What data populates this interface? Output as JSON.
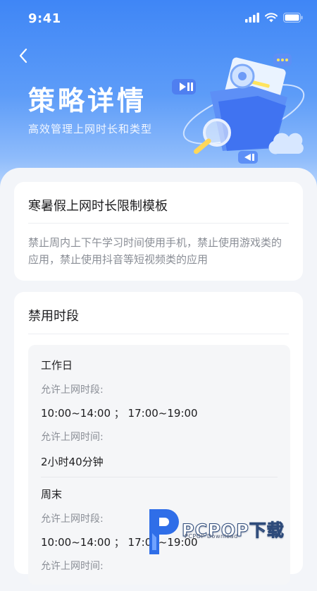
{
  "status_bar": {
    "time": "9:41"
  },
  "header": {
    "title": "策略详情",
    "subtitle": "高效管理上网时长和类型"
  },
  "template": {
    "name": "寒暑假上网时长限制模板",
    "description": "禁止周内上下午学习时间使用手机，禁止使用游戏类的应用，禁止使用抖音等短视频类的应用"
  },
  "ban_section": {
    "title": "禁用时段",
    "groups": [
      {
        "name": "工作日",
        "periods_label": "允许上网时段:",
        "periods_value": "10:00~14:00 ；  17:00~19:00",
        "duration_label": "允许上网时间:",
        "duration_value": "2小时40分钟"
      },
      {
        "name": "周末",
        "periods_label": "允许上网时段:",
        "periods_value": "10:00~14:00 ；  17:00~19:00",
        "duration_label": "允许上网时间:"
      }
    ]
  },
  "watermark": {
    "brand": "PCPOP下载",
    "sub": "PCPOP Download"
  },
  "colors": {
    "primary": "#3f86f6",
    "text": "#1d1d1f",
    "muted": "#8a8e96"
  }
}
